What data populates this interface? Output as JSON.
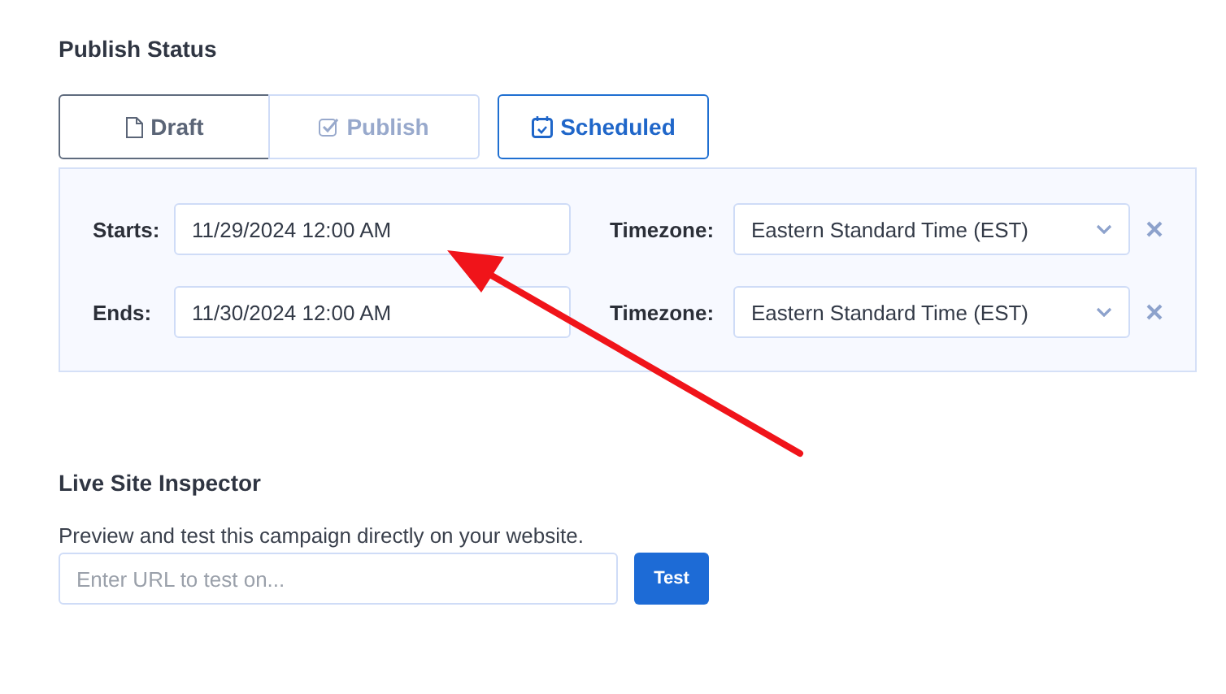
{
  "publish_status": {
    "title": "Publish Status",
    "tabs": [
      {
        "label": "Draft",
        "kind": "draft",
        "selected": false,
        "focused": true,
        "disabled": false
      },
      {
        "label": "Publish",
        "kind": "publish",
        "selected": false,
        "focused": false,
        "disabled": true
      },
      {
        "label": "Scheduled",
        "kind": "scheduled",
        "selected": true,
        "focused": false,
        "disabled": false
      }
    ],
    "schedule": [
      {
        "label": "Starts:",
        "value": "11/29/2024 12:00 AM",
        "timezone_label": "Timezone:",
        "timezone": "Eastern Standard Time (EST)"
      },
      {
        "label": "Ends:",
        "value": "11/30/2024 12:00 AM",
        "timezone_label": "Timezone:",
        "timezone": "Eastern Standard Time (EST)"
      }
    ]
  },
  "live_site_inspector": {
    "title": "Live Site Inspector",
    "description": "Preview and test this campaign directly on your website.",
    "url_placeholder": "Enter URL to test on...",
    "button": "Test"
  }
}
